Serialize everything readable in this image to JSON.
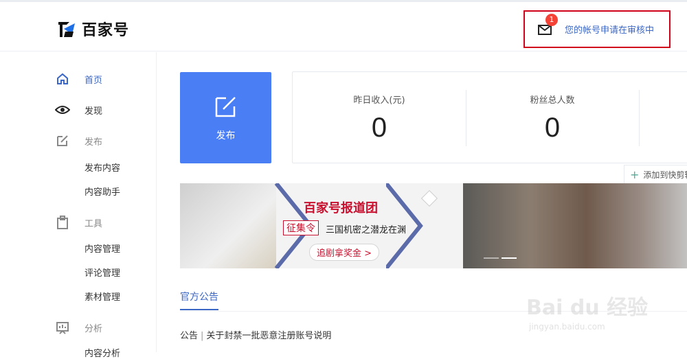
{
  "brand": {
    "name": "百家号"
  },
  "notification": {
    "count": "1",
    "text": "您的帐号申请在审核中"
  },
  "sidebar": {
    "items": [
      {
        "label": "首页",
        "icon": "home-icon"
      },
      {
        "label": "发现",
        "icon": "eye-icon"
      },
      {
        "label": "发布",
        "icon": "edit-icon"
      },
      {
        "label": "发布内容"
      },
      {
        "label": "内容助手"
      },
      {
        "label": "工具",
        "icon": "clipboard-icon"
      },
      {
        "label": "内容管理"
      },
      {
        "label": "评论管理"
      },
      {
        "label": "素材管理"
      },
      {
        "label": "分析",
        "icon": "chart-icon"
      },
      {
        "label": "内容分析"
      }
    ]
  },
  "publish_card": {
    "label": "发布"
  },
  "stats": [
    {
      "label": "昨日收入(元)",
      "value": "0"
    },
    {
      "label": "粉丝总人数",
      "value": "0"
    }
  ],
  "quick_add": {
    "label": "添加到快剪辑"
  },
  "banner": {
    "title": "百家号报道团",
    "tag": "征集令",
    "subtitle": "三国机密之潜龙在渊",
    "button": "追剧拿奖金 >"
  },
  "announcements": {
    "tab": "官方公告",
    "items": [
      {
        "category": "公告",
        "title": "关于封禁一批恶意注册账号说明"
      }
    ]
  },
  "watermark": {
    "main": "Bai du 经验",
    "sub": "jingyan.baidu.com"
  },
  "colors": {
    "accent": "#3a66c5",
    "publish_bg": "#4a7ef5",
    "badge": "#f44336",
    "highlight_border": "#d0021b"
  }
}
